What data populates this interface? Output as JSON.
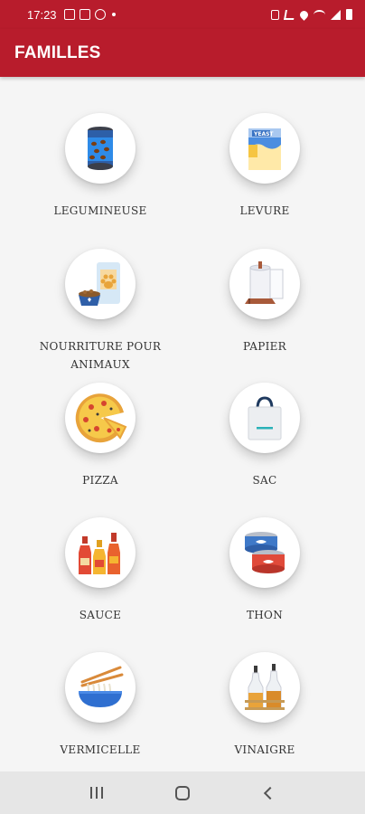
{
  "status_bar": {
    "time": "17:23"
  },
  "app_bar": {
    "title": "FAMILLES"
  },
  "categories": [
    {
      "label": "LEGUMINEUSE",
      "icon": "canned-beans-icon"
    },
    {
      "label": "LEVURE",
      "icon": "yeast-box-icon"
    },
    {
      "label": "NOURRITURE POUR ANIMAUX",
      "icon": "pet-food-icon"
    },
    {
      "label": "PAPIER",
      "icon": "paper-towel-icon"
    },
    {
      "label": "PIZZA",
      "icon": "pizza-icon"
    },
    {
      "label": "SAC",
      "icon": "shopping-bag-icon"
    },
    {
      "label": "SAUCE",
      "icon": "sauce-bottles-icon"
    },
    {
      "label": "THON",
      "icon": "tuna-cans-icon"
    },
    {
      "label": "VERMICELLE",
      "icon": "noodle-bowl-icon"
    },
    {
      "label": "VINAIGRE",
      "icon": "vinegar-bottles-icon"
    }
  ],
  "colors": {
    "primary": "#b81c2c",
    "background": "#f5f5f5",
    "nav_bar": "#e6e6e6"
  }
}
